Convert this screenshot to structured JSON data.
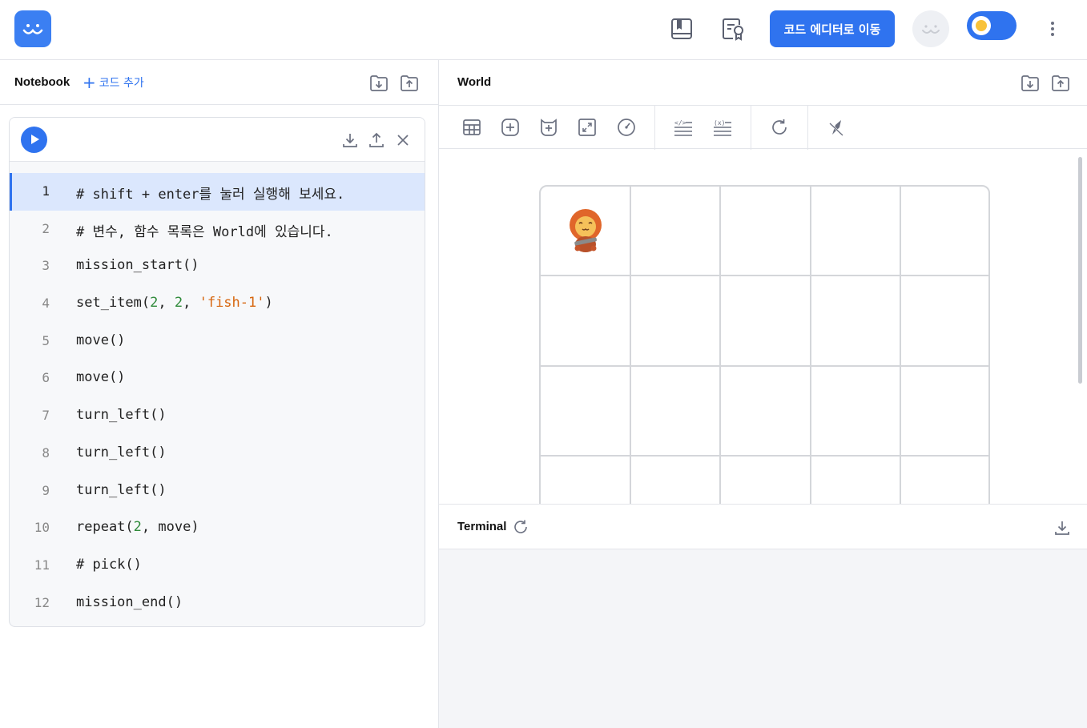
{
  "header": {
    "goto_editor_label": "코드 에디터로 이동",
    "icons": [
      "book-icon",
      "certificate-icon",
      "avatar-icon",
      "theme-toggle",
      "more-vert-icon"
    ],
    "accent_color": "#2f73ef"
  },
  "notebook": {
    "title": "Notebook",
    "add_code_label": "코드 추가",
    "lines": [
      {
        "n": "1",
        "text": "# shift + enter를 눌러 실행해 보세요."
      },
      {
        "n": "2",
        "text": "# 변수, 함수 목록은 World에 있습니다."
      },
      {
        "n": "3",
        "text": "mission_start()"
      },
      {
        "n": "4",
        "text": "set_item(2, 2, 'fish-1')"
      },
      {
        "n": "5",
        "text": "move()"
      },
      {
        "n": "6",
        "text": "move()"
      },
      {
        "n": "7",
        "text": "turn_left()"
      },
      {
        "n": "8",
        "text": "turn_left()"
      },
      {
        "n": "9",
        "text": "turn_left()"
      },
      {
        "n": "10",
        "text": "repeat(2, move)"
      },
      {
        "n": "11",
        "text": "# pick()"
      },
      {
        "n": "12",
        "text": "mission_end()"
      }
    ],
    "active_line": 1
  },
  "world": {
    "title": "World",
    "grid_columns": 5,
    "grid_rows_visible": 4,
    "character": {
      "row": 1,
      "col": 1,
      "icon": "lion-cat-character"
    }
  },
  "terminal": {
    "title": "Terminal"
  }
}
